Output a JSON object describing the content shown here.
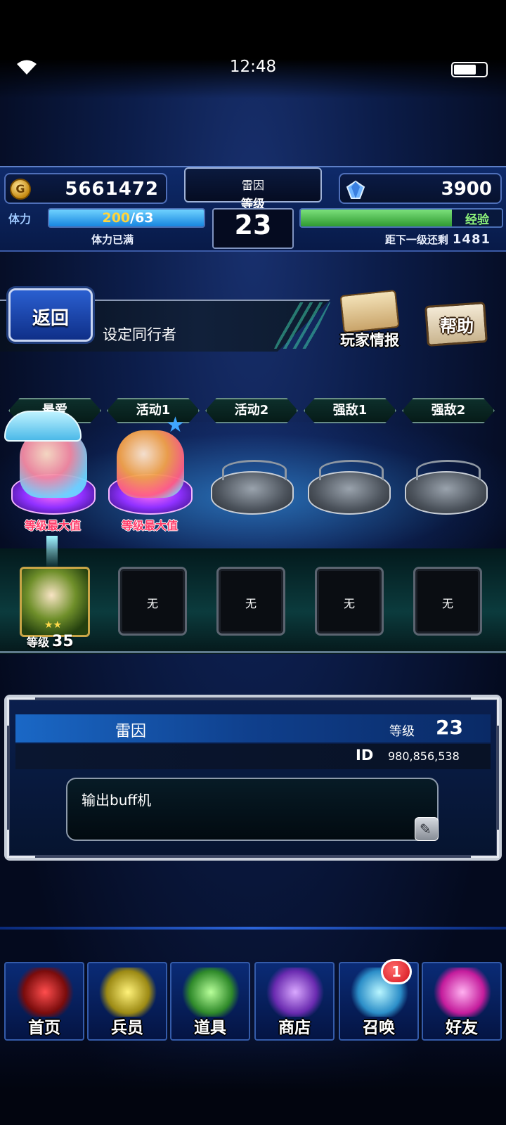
{
  "status_bar": {
    "time": "12:48"
  },
  "header": {
    "gold": "5661472",
    "gems": "3900",
    "player_name": "雷因",
    "level_label": "等级",
    "level": "23",
    "stamina_label": "体力",
    "stamina_current": "200",
    "stamina_max": "/63",
    "stamina_status": "体力已满",
    "exp_label": "经验",
    "exp_fill_fraction": 0.75,
    "exp_next_label": "距下一级还剩",
    "exp_next_value": "1481"
  },
  "titlebar": {
    "back_label": "返回",
    "title": "设定同行者",
    "player_info_label": "玩家情报",
    "help_label": "帮助"
  },
  "tabs": [
    "最爱",
    "活动1",
    "活动2",
    "强敌1",
    "强敌2"
  ],
  "units": [
    {
      "filled": true,
      "status": "等级最大值"
    },
    {
      "filled": true,
      "status": "等级最大值"
    },
    {
      "filled": false,
      "status": ""
    },
    {
      "filled": false,
      "status": ""
    },
    {
      "filled": false,
      "status": ""
    }
  ],
  "equip": {
    "level_label": "等级",
    "level_value": "35",
    "empty_text": "无"
  },
  "profile": {
    "name": "雷因",
    "level_label": "等级",
    "level": "23",
    "id_label": "ID",
    "id_value": "980,856,538",
    "comment": "输出buff机"
  },
  "nav": {
    "items": [
      "首页",
      "兵员",
      "道具",
      "商店",
      "召唤",
      "好友"
    ],
    "summon_badge": "1"
  },
  "colors": {
    "accent_blue": "#1886e0",
    "exp_green": "#2f9a31",
    "badge_red": "#d3121c",
    "max_label": "#ff3e6b"
  }
}
